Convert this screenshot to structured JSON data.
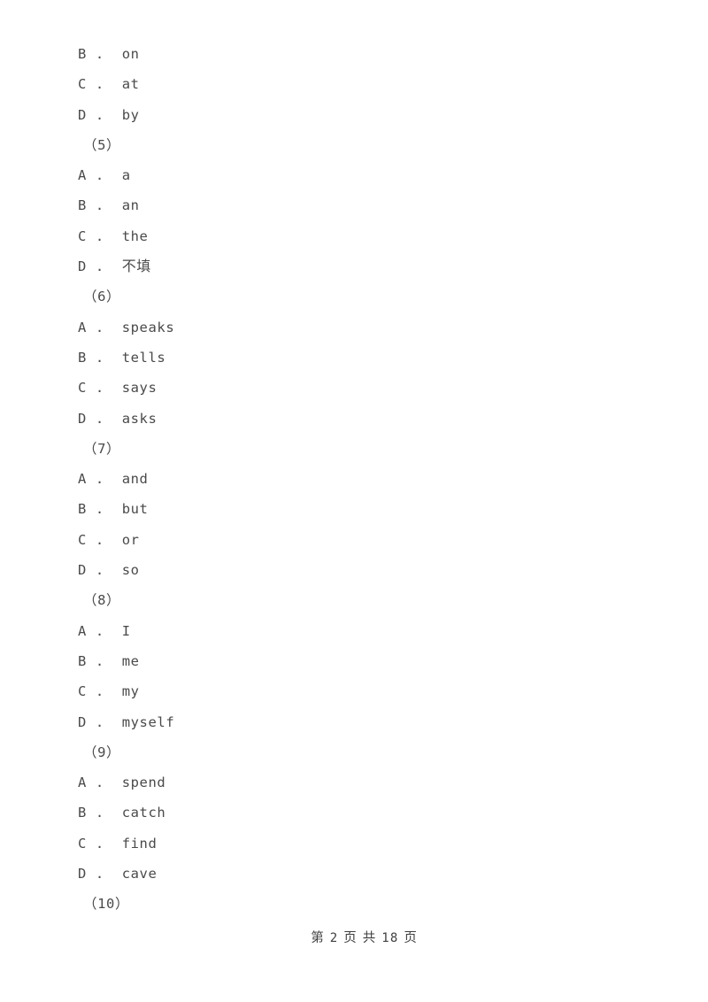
{
  "document": {
    "type": "exam-paper",
    "page_background": "#ffffff",
    "text_color": "#4a4a4a"
  },
  "body_lines": [
    {
      "kind": "option",
      "letter": "B",
      "sep": ".",
      "text": "on",
      "cjk": false
    },
    {
      "kind": "option",
      "letter": "C",
      "sep": ".",
      "text": "at",
      "cjk": false
    },
    {
      "kind": "option",
      "letter": "D",
      "sep": ".",
      "text": "by",
      "cjk": false
    },
    {
      "kind": "question",
      "label": "（5）"
    },
    {
      "kind": "option",
      "letter": "A",
      "sep": ".",
      "text": "a",
      "cjk": false
    },
    {
      "kind": "option",
      "letter": "B",
      "sep": ".",
      "text": "an",
      "cjk": false
    },
    {
      "kind": "option",
      "letter": "C",
      "sep": ".",
      "text": "the",
      "cjk": false
    },
    {
      "kind": "option",
      "letter": "D",
      "sep": ".",
      "text": "不填",
      "cjk": true
    },
    {
      "kind": "question",
      "label": "（6）"
    },
    {
      "kind": "option",
      "letter": "A",
      "sep": ".",
      "text": "speaks",
      "cjk": false
    },
    {
      "kind": "option",
      "letter": "B",
      "sep": ".",
      "text": "tells",
      "cjk": false
    },
    {
      "kind": "option",
      "letter": "C",
      "sep": ".",
      "text": "says",
      "cjk": false
    },
    {
      "kind": "option",
      "letter": "D",
      "sep": ".",
      "text": "asks",
      "cjk": false
    },
    {
      "kind": "question",
      "label": "（7）"
    },
    {
      "kind": "option",
      "letter": "A",
      "sep": ".",
      "text": "and",
      "cjk": false
    },
    {
      "kind": "option",
      "letter": "B",
      "sep": ".",
      "text": "but",
      "cjk": false
    },
    {
      "kind": "option",
      "letter": "C",
      "sep": ".",
      "text": "or",
      "cjk": false
    },
    {
      "kind": "option",
      "letter": "D",
      "sep": ".",
      "text": "so",
      "cjk": false
    },
    {
      "kind": "question",
      "label": "（8）"
    },
    {
      "kind": "option",
      "letter": "A",
      "sep": ".",
      "text": "I",
      "cjk": false
    },
    {
      "kind": "option",
      "letter": "B",
      "sep": ".",
      "text": "me",
      "cjk": false
    },
    {
      "kind": "option",
      "letter": "C",
      "sep": ".",
      "text": "my",
      "cjk": false
    },
    {
      "kind": "option",
      "letter": "D",
      "sep": ".",
      "text": "myself",
      "cjk": false
    },
    {
      "kind": "question",
      "label": "（9）"
    },
    {
      "kind": "option",
      "letter": "A",
      "sep": ".",
      "text": "spend",
      "cjk": false
    },
    {
      "kind": "option",
      "letter": "B",
      "sep": ".",
      "text": "catch",
      "cjk": false
    },
    {
      "kind": "option",
      "letter": "C",
      "sep": ".",
      "text": "find",
      "cjk": false
    },
    {
      "kind": "option",
      "letter": "D",
      "sep": ".",
      "text": "cave",
      "cjk": false
    },
    {
      "kind": "question",
      "label": "（10）"
    }
  ],
  "footer": {
    "prefix": "第",
    "current_page": "2",
    "middle": "页 共",
    "total_pages": "18",
    "suffix": "页",
    "full_text": "第 2 页 共 18 页"
  }
}
